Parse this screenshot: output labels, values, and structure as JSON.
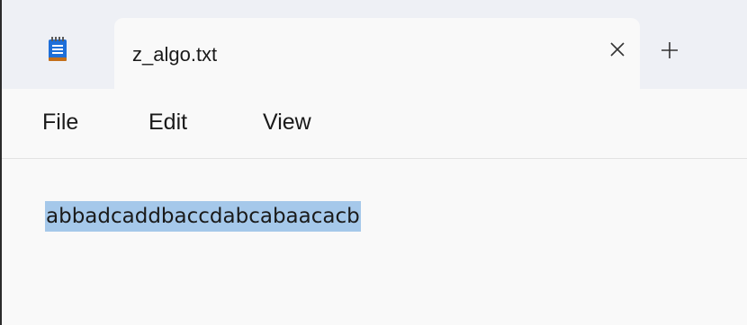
{
  "tab": {
    "title": "z_algo.txt"
  },
  "menu": {
    "items": [
      "File",
      "Edit",
      "View"
    ]
  },
  "editor": {
    "content": "abbadcaddbaccdabcabaacacb"
  },
  "icons": {
    "app": "notepad-icon",
    "close": "close-icon",
    "new_tab": "plus-icon"
  },
  "colors": {
    "selection": "#a5c8ea",
    "titlebar": "#eef0f5",
    "app_icon": "#1e6fd9"
  }
}
